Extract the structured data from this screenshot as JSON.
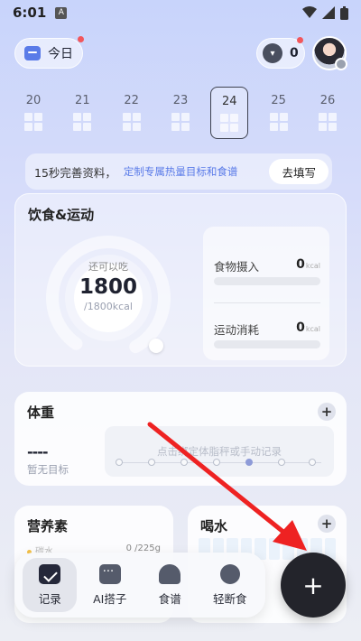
{
  "status_bar": {
    "time": "6:01",
    "badge": "A"
  },
  "header": {
    "today_label": "今日",
    "basket_count": "0"
  },
  "dates": [
    "20",
    "21",
    "22",
    "23",
    "24",
    "25",
    "26"
  ],
  "selected_date_index": 4,
  "banner": {
    "title": "15秒完善资料，",
    "subtitle": "定制专属热量目标和食谱",
    "button": "去填写"
  },
  "diet_card": {
    "title": "饮食&运动",
    "ring_label": "还可以吃",
    "ring_value": "1800",
    "ring_total": "/1800kcal",
    "ring_progress": 0,
    "intake_label": "食物摄入",
    "intake_value": "0",
    "intake_unit": "kcal",
    "exercise_label": "运动消耗",
    "exercise_value": "0",
    "exercise_unit": "kcal"
  },
  "weight_card": {
    "title": "体重",
    "value": "----",
    "goal": "暂无目标",
    "hint": "点击绑定体脂秤或手动记录"
  },
  "nutrition_card": {
    "title": "营养素",
    "row_label": "碳水",
    "row_value": "0 /225g"
  },
  "water_card": {
    "title": "喝水"
  },
  "bottom_nav": [
    {
      "label": "记录",
      "icon": "calendar-check-icon"
    },
    {
      "label": "AI搭子",
      "icon": "chat-bubble-icon"
    },
    {
      "label": "食谱",
      "icon": "chef-hat-icon"
    },
    {
      "label": "轻断食",
      "icon": "stopwatch-icon"
    }
  ],
  "fab_label": "+",
  "colors": {
    "accent": "#5a7be8",
    "fab": "#23242b",
    "annotation_arrow": "#ee2222"
  }
}
